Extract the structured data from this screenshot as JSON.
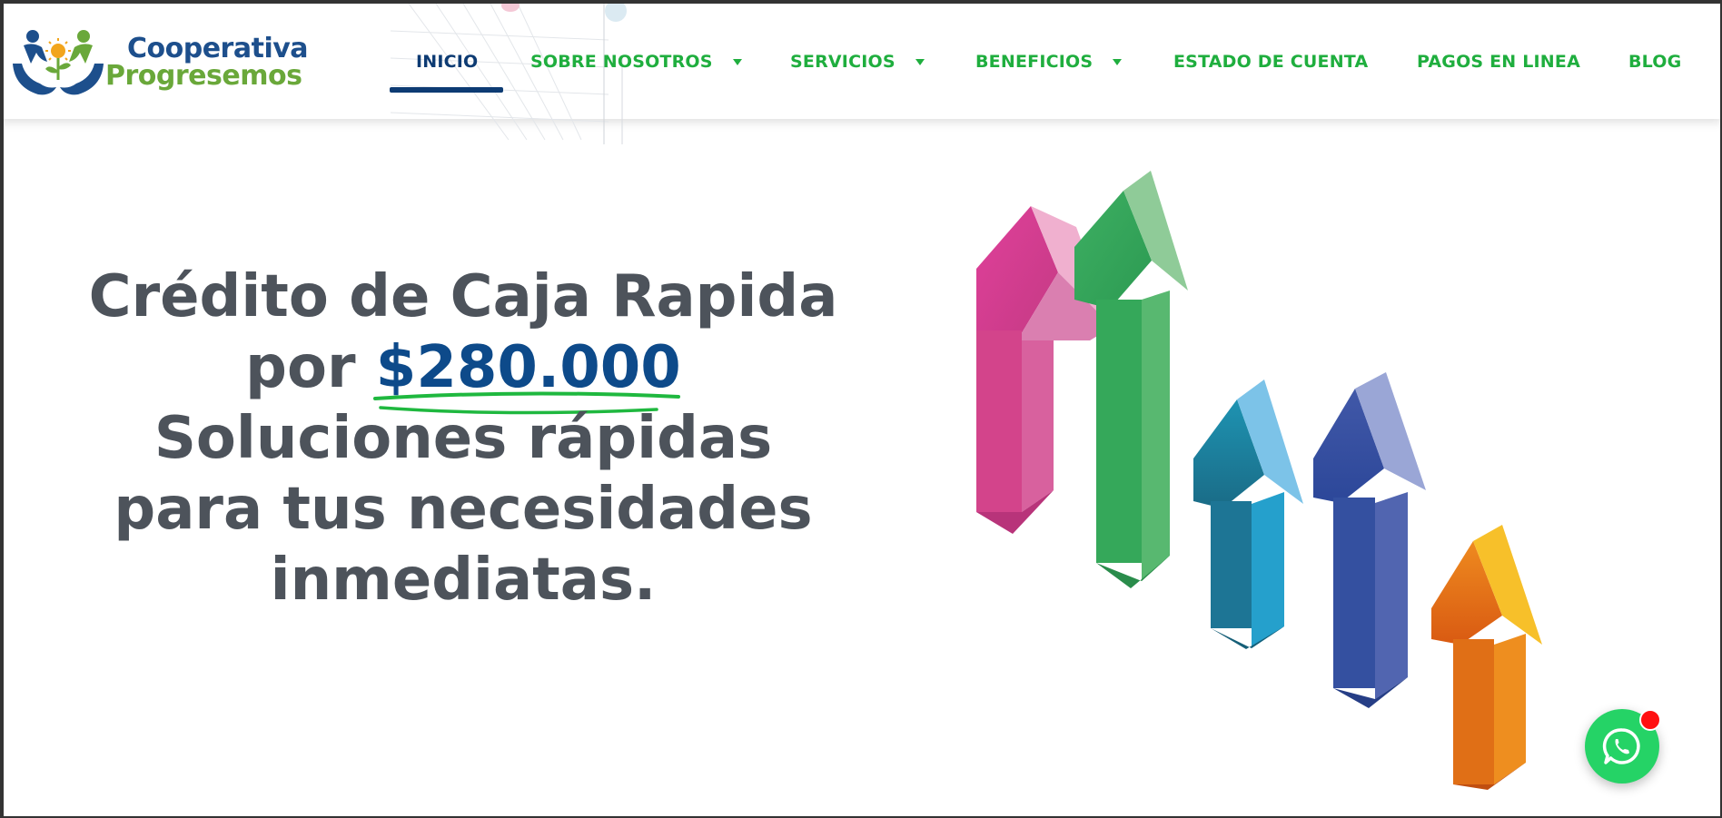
{
  "brand": {
    "line1": "Cooperativa",
    "line2": "Progresemos",
    "primary_color": "#1d4f8c",
    "secondary_color": "#6aa83a"
  },
  "nav": {
    "items": [
      {
        "label": "INICIO",
        "active": true,
        "has_dropdown": false
      },
      {
        "label": "SOBRE NOSOTROS",
        "active": false,
        "has_dropdown": true
      },
      {
        "label": "SERVICIOS",
        "active": false,
        "has_dropdown": true
      },
      {
        "label": "BENEFICIOS",
        "active": false,
        "has_dropdown": true
      },
      {
        "label": "ESTADO DE CUENTA",
        "active": false,
        "has_dropdown": false
      },
      {
        "label": "PAGOS EN LINEA",
        "active": false,
        "has_dropdown": false
      },
      {
        "label": "BLOG",
        "active": false,
        "has_dropdown": false
      }
    ],
    "link_color": "#1fae3e",
    "active_color": "#0d3b73"
  },
  "hero": {
    "line1": "Crédito de Caja Rapida",
    "line2_prefix": "por ",
    "amount": "$280.000",
    "line3": "Soluciones rápidas",
    "line4": "para tus necesidades",
    "line5": "inmediatas.",
    "text_color": "#4d535b",
    "amount_color": "#0d4a8a",
    "underline_color": "#1fb83f"
  },
  "illustration": {
    "arrows": [
      "pink",
      "green",
      "teal",
      "blue",
      "orange"
    ]
  },
  "whatsapp": {
    "icon": "whatsapp-icon",
    "badge_color": "#ff1010",
    "button_color": "#25d366"
  }
}
